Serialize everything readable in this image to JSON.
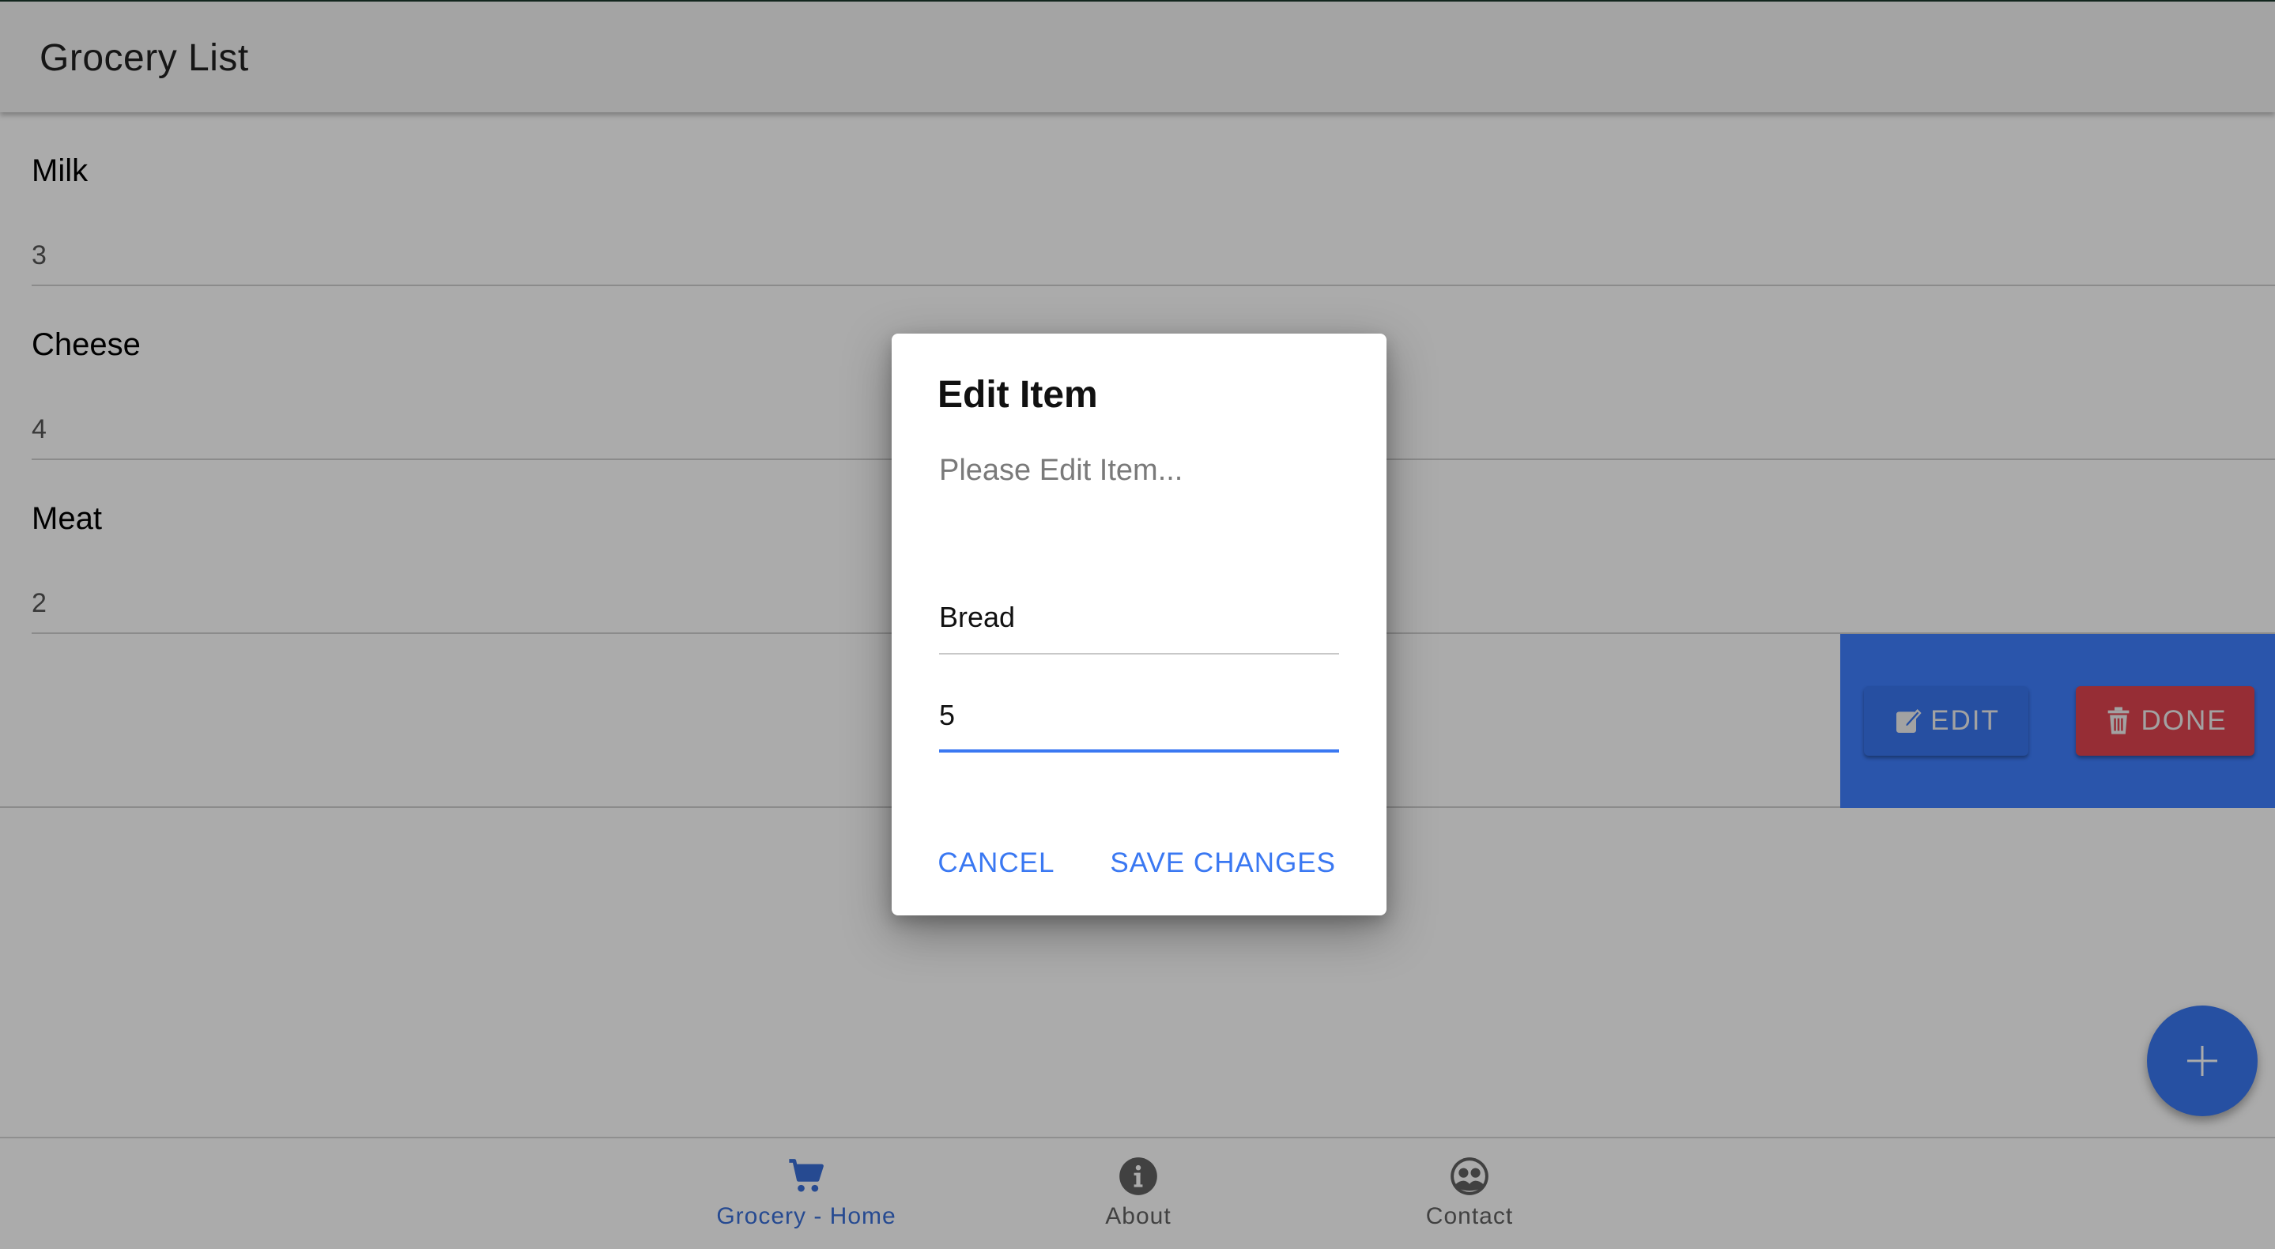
{
  "appbar": {
    "title": "Grocery List"
  },
  "items": [
    {
      "name": "Milk",
      "qty": "3"
    },
    {
      "name": "Cheese",
      "qty": "4"
    },
    {
      "name": "Meat",
      "qty": "2"
    }
  ],
  "swipe_actions": {
    "edit_label": "EDIT",
    "done_label": "DONE"
  },
  "fab": {
    "icon": "plus-icon"
  },
  "bottom_nav": {
    "items": [
      {
        "label": "Grocery - Home",
        "icon": "cart-icon",
        "active": true
      },
      {
        "label": "About",
        "icon": "info-icon",
        "active": false
      },
      {
        "label": "Contact",
        "icon": "people-icon",
        "active": false
      }
    ]
  },
  "dialog": {
    "title": "Edit Item",
    "text": "Please Edit Item...",
    "name_value": "Bread",
    "qty_value": "5",
    "cancel_label": "CANCEL",
    "save_label": "SAVE CHANGES"
  },
  "colors": {
    "accent": "#3a78f2",
    "danger": "#e0434f",
    "swipe_bg": "#3f7fff"
  }
}
